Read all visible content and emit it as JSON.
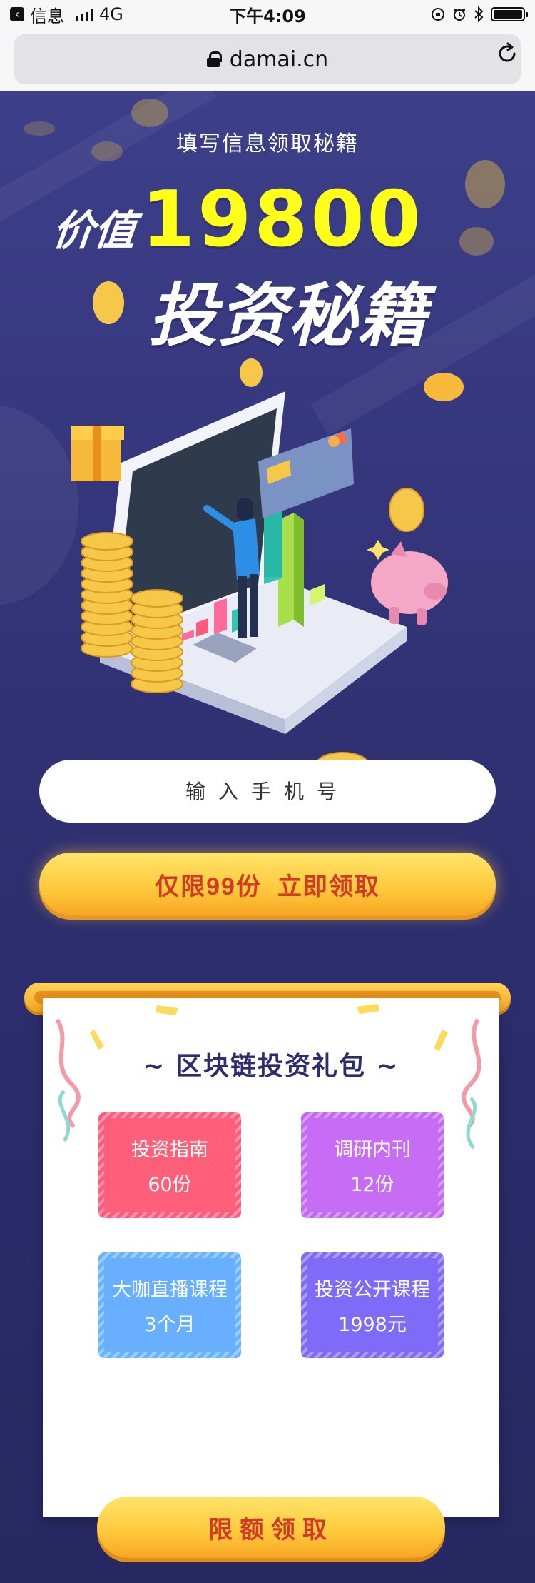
{
  "status_bar": {
    "carrier": "信息",
    "network": "4G",
    "time": "下午4:09"
  },
  "browser": {
    "url": "damai.cn"
  },
  "hero": {
    "subtitle": "填写信息领取秘籍",
    "value_prefix": "价值",
    "value_number": "19800",
    "headline": "投资秘籍"
  },
  "form": {
    "phone_placeholder": "输入手机号",
    "claim_button": {
      "quantity_text": "仅限99份",
      "action_text": "立即领取"
    }
  },
  "gift_panel": {
    "title": "~ 区块链投资礼包 ~",
    "items": [
      {
        "name": "投资指南",
        "amount": "60份"
      },
      {
        "name": "调研内刊",
        "amount": "12份"
      },
      {
        "name": "大咖直播课程",
        "amount": "3个月"
      },
      {
        "name": "投资公开课程",
        "amount": "1998元"
      }
    ],
    "button_label": "限额领取"
  },
  "colors": {
    "background": "#2a2d6b",
    "accent_yellow": "#ffff1a",
    "button_text": "#d33a25"
  }
}
